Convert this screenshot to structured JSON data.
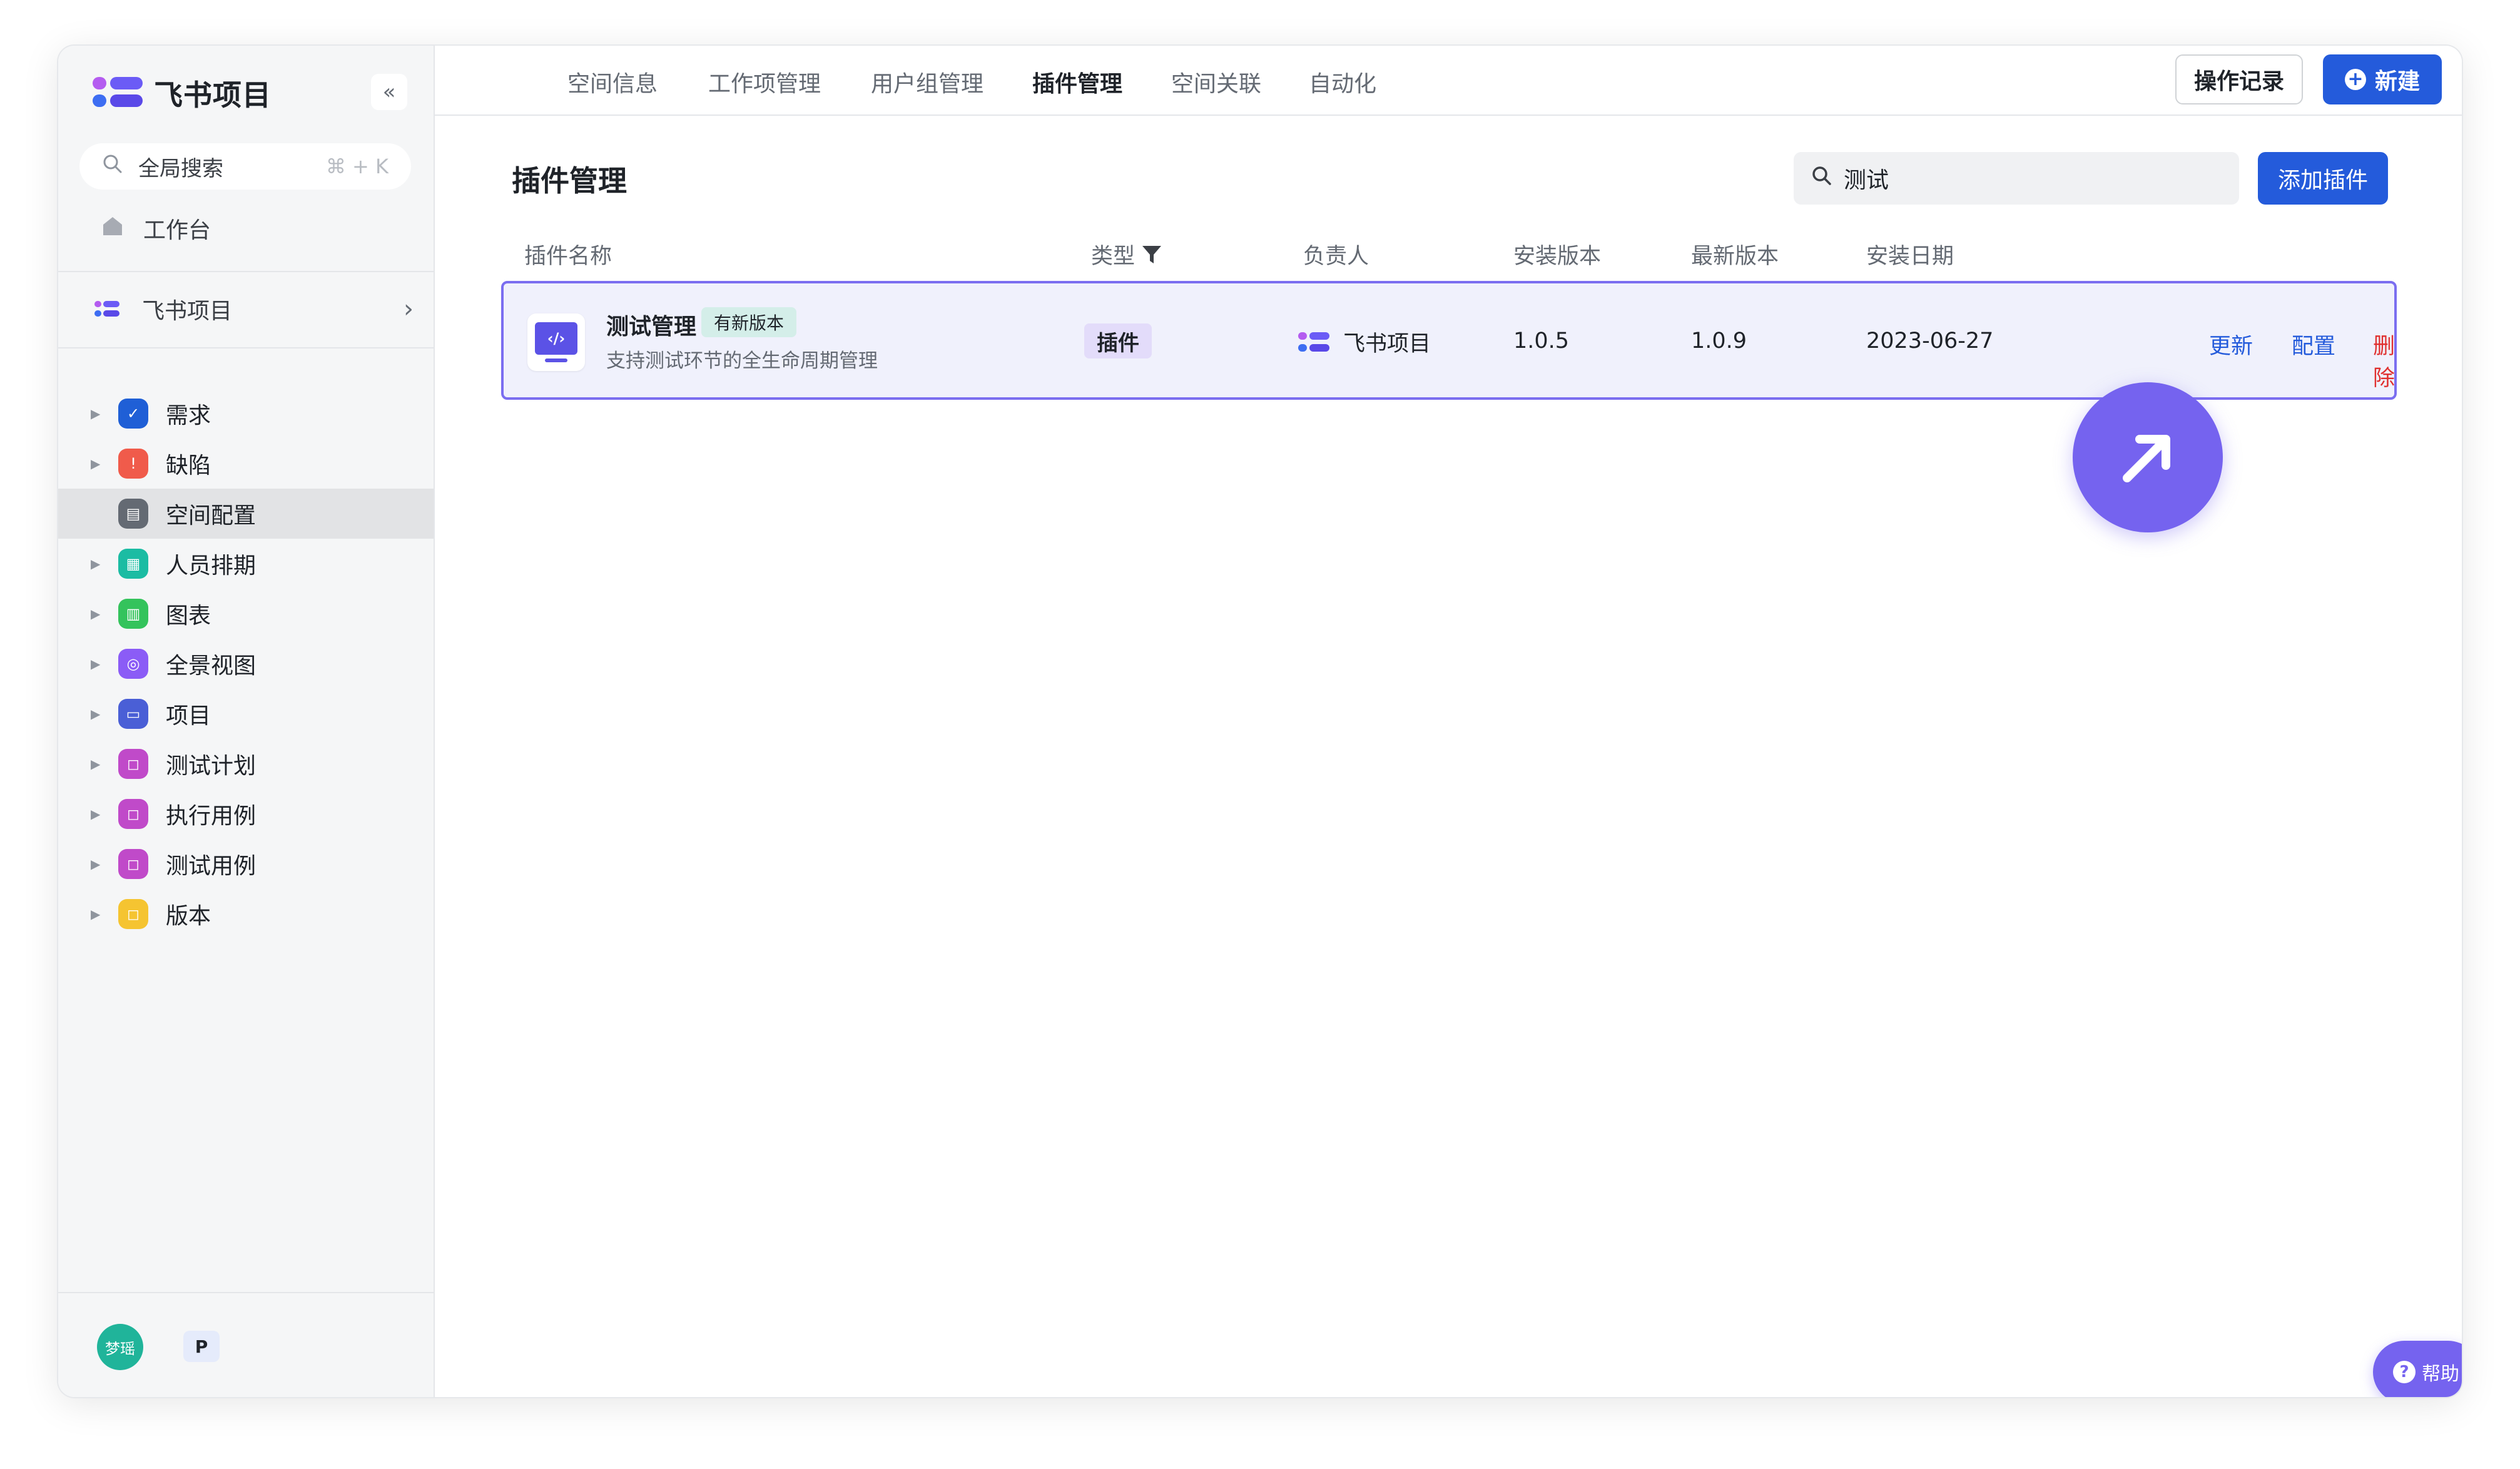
{
  "app": {
    "name": "飞书项目"
  },
  "sidebar": {
    "collapse_label": "«",
    "search": {
      "placeholder": "全局搜索",
      "shortcut": "⌘ + K"
    },
    "workbench_label": "工作台",
    "project": {
      "name": "飞书项目",
      "chevron": "›"
    },
    "items": [
      {
        "label": "需求",
        "icon": "check-circle-icon",
        "color": "#1f5fd6",
        "glyph": "✓"
      },
      {
        "label": "缺陷",
        "icon": "alert-icon",
        "color": "#f05b4b",
        "glyph": "!"
      },
      {
        "label": "空间配置",
        "icon": "config-icon",
        "color": "#646a73",
        "glyph": "▤"
      },
      {
        "label": "人员排期",
        "icon": "schedule-icon",
        "color": "#1bbca3",
        "glyph": "▦"
      },
      {
        "label": "图表",
        "icon": "chart-icon",
        "color": "#34c35c",
        "glyph": "▥"
      },
      {
        "label": "全景视图",
        "icon": "panorama-icon",
        "color": "#8b5cf6",
        "glyph": "◎"
      },
      {
        "label": "项目",
        "icon": "folder-icon",
        "color": "#4a5fd6",
        "glyph": "▭"
      },
      {
        "label": "测试计划",
        "icon": "bookmark-icon",
        "color": "#c04ac9",
        "glyph": "◻"
      },
      {
        "label": "执行用例",
        "icon": "bookmark-icon",
        "color": "#c04ac9",
        "glyph": "◻"
      },
      {
        "label": "测试用例",
        "icon": "bookmark-icon",
        "color": "#c04ac9",
        "glyph": "◻"
      },
      {
        "label": "版本",
        "icon": "bookmark-icon",
        "color": "#f5c431",
        "glyph": "◻"
      }
    ],
    "active_index": 2,
    "user": {
      "avatar_text": "梦瑶",
      "badge": "P"
    }
  },
  "topbar": {
    "tabs": [
      "空间信息",
      "工作项管理",
      "用户组管理",
      "插件管理",
      "空间关联",
      "自动化"
    ],
    "active_tab": "插件管理",
    "log_button": "操作记录",
    "new_button": "新建",
    "new_icon": "+"
  },
  "main": {
    "title": "插件管理",
    "search_value": "测试",
    "add_button": "添加插件",
    "columns": {
      "name": "插件名称",
      "type": "类型",
      "owner": "负责人",
      "installed": "安装版本",
      "latest": "最新版本",
      "date": "安装日期"
    },
    "rows": [
      {
        "name": "测试管理",
        "tag": "有新版本",
        "description": "支持测试环节的全生命周期管理",
        "icon_glyph": "‹/›",
        "type": "插件",
        "owner": "飞书项目",
        "installed": "1.0.5",
        "latest": "1.0.9",
        "date": "2023-06-27",
        "actions": {
          "update": "更新",
          "config": "配置",
          "delete": "删除"
        }
      }
    ]
  },
  "help": {
    "label": "帮助",
    "icon": "?"
  },
  "colors": {
    "brand": "#245bdb",
    "accent": "#7563ef",
    "danger": "#e0302f",
    "row_highlight": "#f0f1fc"
  }
}
